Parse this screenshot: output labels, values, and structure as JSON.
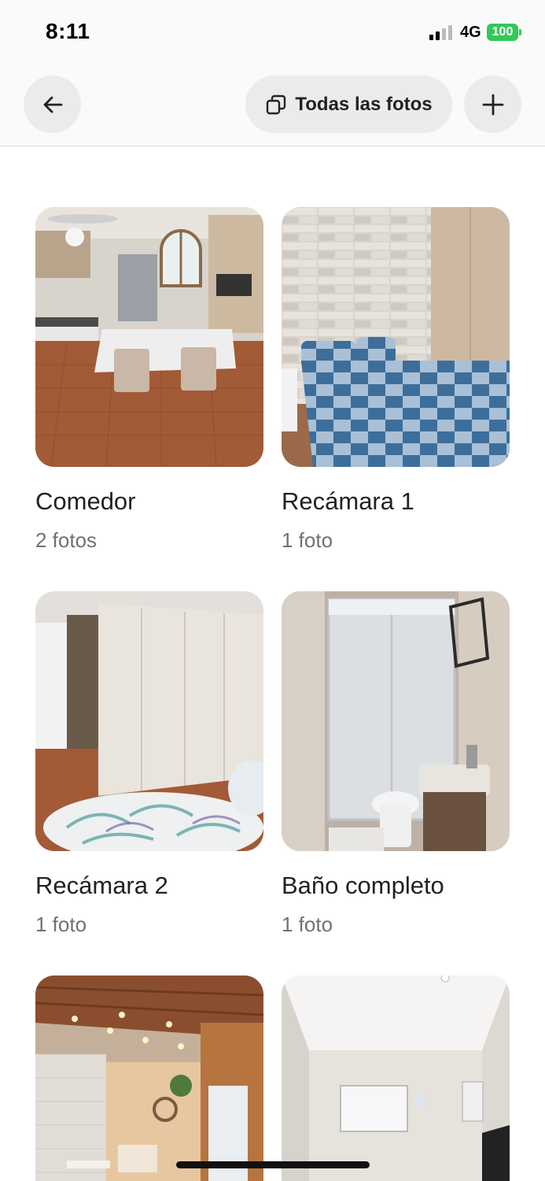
{
  "status_bar": {
    "time": "8:11",
    "network": "4G",
    "battery": "100"
  },
  "header": {
    "back_icon": "arrow-left-icon",
    "all_photos_label": "Todas las fotos",
    "all_photos_icon": "photo-stack-icon",
    "add_icon": "plus-icon"
  },
  "rooms": [
    {
      "title": "Comedor",
      "count": "2 fotos"
    },
    {
      "title": "Recámara 1",
      "count": "1 foto"
    },
    {
      "title": "Recámara 2",
      "count": "1 foto"
    },
    {
      "title": "Baño completo",
      "count": "1 foto"
    },
    {
      "title": "",
      "count": ""
    },
    {
      "title": "",
      "count": ""
    }
  ],
  "colors": {
    "battery": "#34c759",
    "button_bg": "#ebebeb",
    "subtitle": "#717171"
  }
}
